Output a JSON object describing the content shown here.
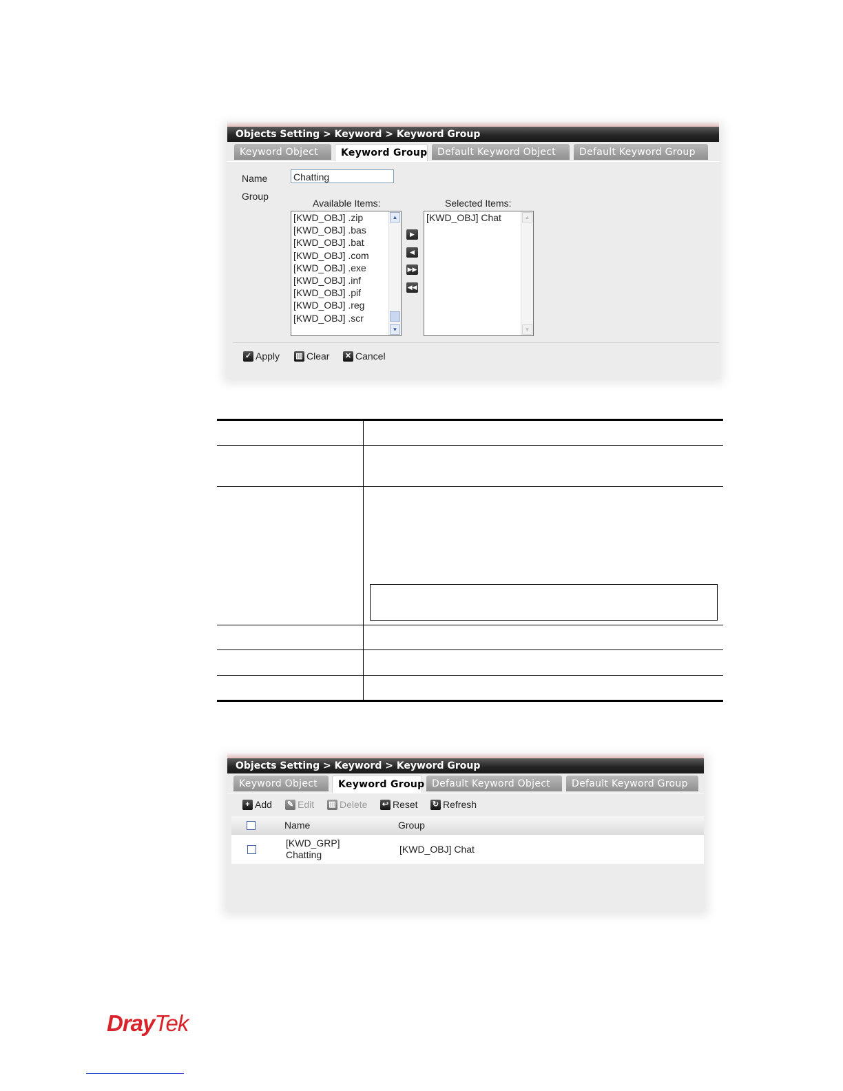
{
  "panel1": {
    "title": "Objects Setting > Keyword > Keyword Group",
    "tabs": [
      "Keyword Object",
      "Keyword Group",
      "Default Keyword Object",
      "Default Keyword Group"
    ],
    "active_tab": "Keyword Group",
    "name_label": "Name",
    "name_value": "Chatting",
    "group_label": "Group",
    "available_label": "Available Items:",
    "selected_label": "Selected Items:",
    "available_items": [
      "[KWD_OBJ] .zip",
      "[KWD_OBJ] .bas",
      "[KWD_OBJ] .bat",
      "[KWD_OBJ] .com",
      "[KWD_OBJ] .exe",
      "[KWD_OBJ] .inf",
      "[KWD_OBJ] .pif",
      "[KWD_OBJ] .reg",
      "[KWD_OBJ] .scr"
    ],
    "selected_items": [
      "[KWD_OBJ] Chat"
    ],
    "move_buttons": [
      "move-right-icon",
      "move-left-icon",
      "move-all-right-icon",
      "move-all-left-icon"
    ],
    "apply_label": "Apply",
    "clear_label": "Clear",
    "cancel_label": "Cancel"
  },
  "panel2": {
    "title": "Objects Setting > Keyword > Keyword Group",
    "tabs": [
      "Keyword Object",
      "Keyword Group",
      "Default Keyword Object",
      "Default Keyword Group"
    ],
    "active_tab": "Keyword Group",
    "toolbar": {
      "add_label": "Add",
      "edit_label": "Edit",
      "delete_label": "Delete",
      "reset_label": "Reset",
      "refresh_label": "Refresh"
    },
    "columns": [
      "Name",
      "Group"
    ],
    "rows": [
      {
        "name_line1": "[KWD_GRP]",
        "name_line2": "Chatting",
        "group": "[KWD_OBJ] Chat"
      }
    ]
  },
  "footer": {
    "logo_part1": "Dray",
    "logo_part2": "Tek",
    "brand_color": "#d8232a"
  }
}
